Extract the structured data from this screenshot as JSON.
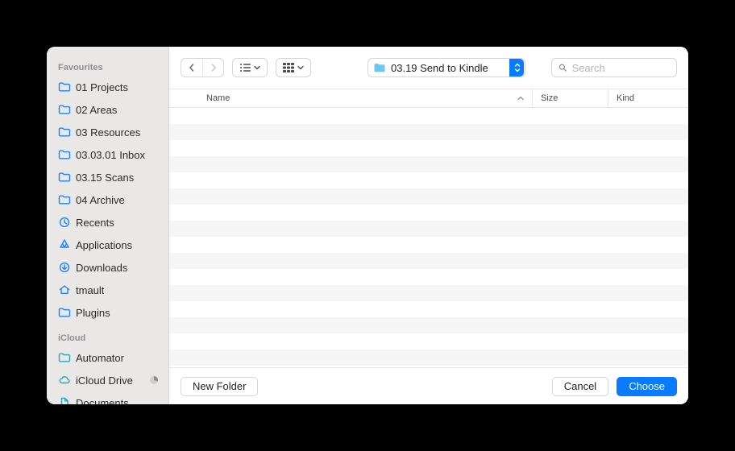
{
  "sidebar": {
    "sections": [
      {
        "header": "Favourites",
        "items": [
          {
            "icon": "folder",
            "label": "01 Projects"
          },
          {
            "icon": "folder",
            "label": "02 Areas"
          },
          {
            "icon": "folder",
            "label": "03 Resources"
          },
          {
            "icon": "folder",
            "label": "03.03.01 Inbox"
          },
          {
            "icon": "folder",
            "label": "03.15 Scans"
          },
          {
            "icon": "folder",
            "label": "04 Archive"
          },
          {
            "icon": "clock",
            "label": "Recents"
          },
          {
            "icon": "apps",
            "label": "Applications"
          },
          {
            "icon": "download",
            "label": "Downloads"
          },
          {
            "icon": "home",
            "label": "tmault"
          },
          {
            "icon": "folder",
            "label": "Plugins"
          }
        ]
      },
      {
        "header": "iCloud",
        "items": [
          {
            "icon": "folder",
            "label": "Automator"
          },
          {
            "icon": "cloud",
            "label": "iCloud Drive",
            "trailing": "pie"
          },
          {
            "icon": "doc",
            "label": "Documents"
          }
        ]
      }
    ]
  },
  "toolbar": {
    "path_label": "03.19 Send to Kindle",
    "search_placeholder": "Search"
  },
  "table": {
    "columns": {
      "name": "Name",
      "size": "Size",
      "kind": "Kind"
    },
    "rows": 16
  },
  "footer": {
    "new_folder": "New Folder",
    "cancel": "Cancel",
    "choose": "Choose"
  },
  "colors": {
    "accent": "#0a7aff",
    "sidebar_icon": "#1e82ff",
    "icloud_icon": "#2aa8b8"
  }
}
